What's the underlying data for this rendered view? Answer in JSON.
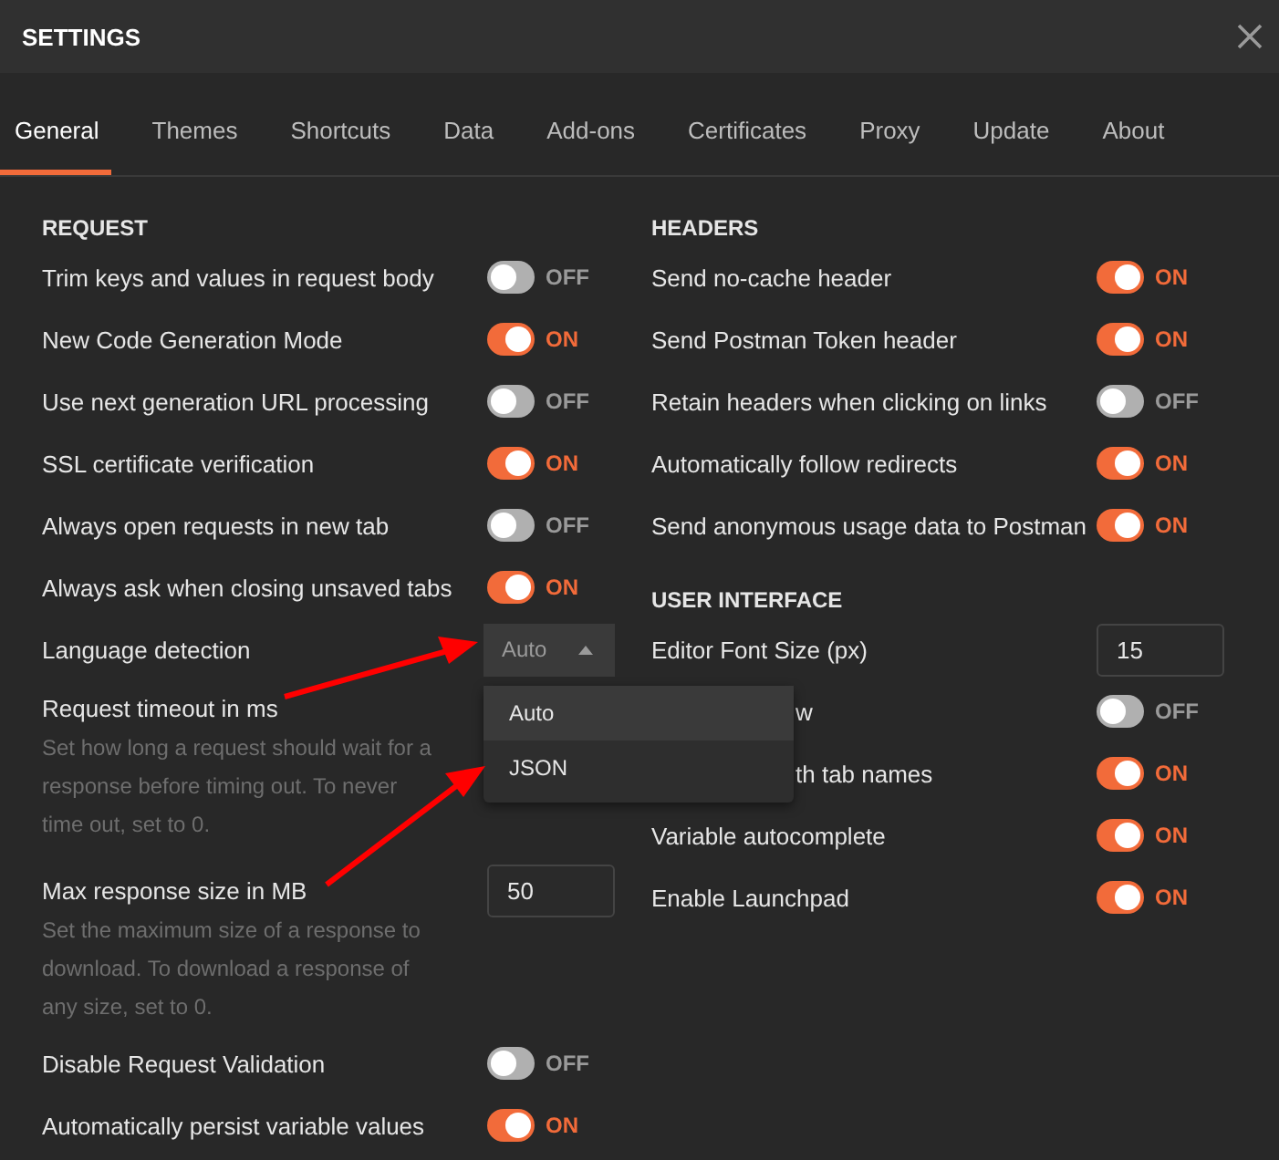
{
  "window": {
    "title": "SETTINGS"
  },
  "tabs": [
    {
      "label": "General",
      "selected": true
    },
    {
      "label": "Themes",
      "selected": false
    },
    {
      "label": "Shortcuts",
      "selected": false
    },
    {
      "label": "Data",
      "selected": false
    },
    {
      "label": "Add-ons",
      "selected": false
    },
    {
      "label": "Certificates",
      "selected": false
    },
    {
      "label": "Proxy",
      "selected": false
    },
    {
      "label": "Update",
      "selected": false
    },
    {
      "label": "About",
      "selected": false
    }
  ],
  "left": {
    "heading": "REQUEST",
    "items": [
      {
        "kind": "toggle",
        "label": "Trim keys and values in request body",
        "on": false,
        "state": "OFF"
      },
      {
        "kind": "toggle",
        "label": "New Code Generation Mode",
        "on": true,
        "state": "ON"
      },
      {
        "kind": "toggle",
        "label": "Use next generation URL processing",
        "on": false,
        "state": "OFF"
      },
      {
        "kind": "toggle",
        "label": "SSL certificate verification",
        "on": true,
        "state": "ON"
      },
      {
        "kind": "toggle",
        "label": "Always open requests in new tab",
        "on": false,
        "state": "OFF"
      },
      {
        "kind": "toggle",
        "label": "Always ask when closing unsaved tabs",
        "on": true,
        "state": "ON"
      },
      {
        "kind": "select",
        "label": "Language detection",
        "value": "Auto",
        "expanded": true,
        "options": [
          {
            "label": "Auto",
            "selected": true
          },
          {
            "label": "JSON",
            "selected": false
          }
        ]
      },
      {
        "kind": "number",
        "label": "Request timeout in ms",
        "description": "Set how long a request should wait for a response before timing out. To never time out, set to 0."
      },
      {
        "kind": "number",
        "label": "Max response size in MB",
        "value": "50",
        "description": "Set the maximum size of a response to download. To download a response of any size, set to 0."
      },
      {
        "kind": "toggle",
        "label": "Disable Request Validation",
        "on": false,
        "state": "OFF"
      },
      {
        "kind": "toggle",
        "label": "Automatically persist variable values",
        "on": true,
        "state": "ON"
      }
    ]
  },
  "right": [
    {
      "heading": "HEADERS",
      "items": [
        {
          "kind": "toggle",
          "label": "Send no-cache header",
          "on": true,
          "state": "ON"
        },
        {
          "kind": "toggle",
          "label": "Send Postman Token header",
          "on": true,
          "state": "ON"
        },
        {
          "kind": "toggle",
          "label": "Retain headers when clicking on links",
          "on": false,
          "state": "OFF"
        },
        {
          "kind": "toggle",
          "label": "Automatically follow redirects",
          "on": true,
          "state": "ON"
        },
        {
          "kind": "toggle",
          "label": "Send anonymous usage data to Postman",
          "on": true,
          "state": "ON"
        }
      ]
    },
    {
      "heading": "USER INTERFACE",
      "items": [
        {
          "kind": "number",
          "label": "Editor Font Size (px)",
          "value": "15"
        },
        {
          "kind": "toggle",
          "label": "w",
          "partly_hidden": true,
          "on": false,
          "state": "OFF"
        },
        {
          "kind": "toggle",
          "label": "th tab names",
          "partly_hidden": true,
          "on": true,
          "state": "ON"
        },
        {
          "kind": "toggle",
          "label": "Variable autocomplete",
          "on": true,
          "state": "ON"
        },
        {
          "kind": "toggle",
          "label": "Enable Launchpad",
          "on": true,
          "state": "ON"
        }
      ]
    }
  ]
}
